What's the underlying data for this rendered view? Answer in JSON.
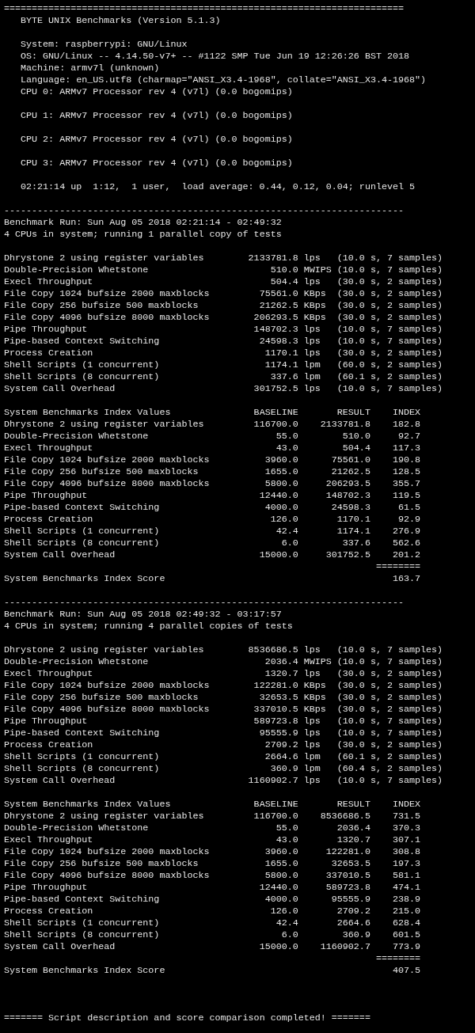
{
  "header": {
    "rule": "========================================================================",
    "title": "BYTE UNIX Benchmarks (Version 5.1.3)",
    "groups": [
      [
        "System: raspberrypi: GNU/Linux",
        "OS: GNU/Linux -- 4.14.50-v7+ -- #1122 SMP Tue Jun 19 12:26:26 BST 2018",
        "Machine: armv7l (unknown)",
        "Language: en_US.utf8 (charmap=\"ANSI_X3.4-1968\", collate=\"ANSI_X3.4-1968\")",
        "CPU 0: ARMv7 Processor rev 4 (v7l) (0.0 bogomips)"
      ],
      [
        "CPU 1: ARMv7 Processor rev 4 (v7l) (0.0 bogomips)"
      ],
      [
        "CPU 2: ARMv7 Processor rev 4 (v7l) (0.0 bogomips)"
      ],
      [
        "CPU 3: ARMv7 Processor rev 4 (v7l) (0.0 bogomips)"
      ],
      [
        "02:21:14 up  1:12,  1 user,  load average: 0.44, 0.12, 0.04; runlevel 5"
      ]
    ]
  },
  "runs": [
    {
      "rule": "------------------------------------------------------------------------",
      "run": "Benchmark Run: Sun Aug 05 2018 02:21:14 - 02:49:32",
      "cpus": "4 CPUs in system; running 1 parallel copy of tests",
      "results": [
        {
          "test": "Dhrystone 2 using register variables",
          "value": "2133781.8",
          "unit": "lps",
          "timing": "(10.0 s, 7 samples)"
        },
        {
          "test": "Double-Precision Whetstone",
          "value": "510.0",
          "unit": "MWIPS",
          "timing": "(10.0 s, 7 samples)"
        },
        {
          "test": "Execl Throughput",
          "value": "504.4",
          "unit": "lps",
          "timing": "(30.0 s, 2 samples)"
        },
        {
          "test": "File Copy 1024 bufsize 2000 maxblocks",
          "value": "75561.0",
          "unit": "KBps",
          "timing": "(30.0 s, 2 samples)"
        },
        {
          "test": "File Copy 256 bufsize 500 maxblocks",
          "value": "21262.5",
          "unit": "KBps",
          "timing": "(30.0 s, 2 samples)"
        },
        {
          "test": "File Copy 4096 bufsize 8000 maxblocks",
          "value": "206293.5",
          "unit": "KBps",
          "timing": "(30.0 s, 2 samples)"
        },
        {
          "test": "Pipe Throughput",
          "value": "148702.3",
          "unit": "lps",
          "timing": "(10.0 s, 7 samples)"
        },
        {
          "test": "Pipe-based Context Switching",
          "value": "24598.3",
          "unit": "lps",
          "timing": "(10.0 s, 7 samples)"
        },
        {
          "test": "Process Creation",
          "value": "1170.1",
          "unit": "lps",
          "timing": "(30.0 s, 2 samples)"
        },
        {
          "test": "Shell Scripts (1 concurrent)",
          "value": "1174.1",
          "unit": "lpm",
          "timing": "(60.0 s, 2 samples)"
        },
        {
          "test": "Shell Scripts (8 concurrent)",
          "value": "337.6",
          "unit": "lpm",
          "timing": "(60.1 s, 2 samples)"
        },
        {
          "test": "System Call Overhead",
          "value": "301752.5",
          "unit": "lps",
          "timing": "(10.0 s, 7 samples)"
        }
      ],
      "index": {
        "title": "System Benchmarks Index Values",
        "columns": [
          "BASELINE",
          "RESULT",
          "INDEX"
        ],
        "rows": [
          {
            "test": "Dhrystone 2 using register variables",
            "baseline": "116700.0",
            "result": "2133781.8",
            "index": "182.8"
          },
          {
            "test": "Double-Precision Whetstone",
            "baseline": "55.0",
            "result": "510.0",
            "index": "92.7"
          },
          {
            "test": "Execl Throughput",
            "baseline": "43.0",
            "result": "504.4",
            "index": "117.3"
          },
          {
            "test": "File Copy 1024 bufsize 2000 maxblocks",
            "baseline": "3960.0",
            "result": "75561.0",
            "index": "190.8"
          },
          {
            "test": "File Copy 256 bufsize 500 maxblocks",
            "baseline": "1655.0",
            "result": "21262.5",
            "index": "128.5"
          },
          {
            "test": "File Copy 4096 bufsize 8000 maxblocks",
            "baseline": "5800.0",
            "result": "206293.5",
            "index": "355.7"
          },
          {
            "test": "Pipe Throughput",
            "baseline": "12440.0",
            "result": "148702.3",
            "index": "119.5"
          },
          {
            "test": "Pipe-based Context Switching",
            "baseline": "4000.0",
            "result": "24598.3",
            "index": "61.5"
          },
          {
            "test": "Process Creation",
            "baseline": "126.0",
            "result": "1170.1",
            "index": "92.9"
          },
          {
            "test": "Shell Scripts (1 concurrent)",
            "baseline": "42.4",
            "result": "1174.1",
            "index": "276.9"
          },
          {
            "test": "Shell Scripts (8 concurrent)",
            "baseline": "6.0",
            "result": "337.6",
            "index": "562.6"
          },
          {
            "test": "System Call Overhead",
            "baseline": "15000.0",
            "result": "301752.5",
            "index": "201.2"
          }
        ],
        "rule": "========",
        "score_label": "System Benchmarks Index Score",
        "score": "163.7"
      }
    },
    {
      "rule": "------------------------------------------------------------------------",
      "run": "Benchmark Run: Sun Aug 05 2018 02:49:32 - 03:17:57",
      "cpus": "4 CPUs in system; running 4 parallel copies of tests",
      "results": [
        {
          "test": "Dhrystone 2 using register variables",
          "value": "8536686.5",
          "unit": "lps",
          "timing": "(10.0 s, 7 samples)"
        },
        {
          "test": "Double-Precision Whetstone",
          "value": "2036.4",
          "unit": "MWIPS",
          "timing": "(10.0 s, 7 samples)"
        },
        {
          "test": "Execl Throughput",
          "value": "1320.7",
          "unit": "lps",
          "timing": "(30.0 s, 2 samples)"
        },
        {
          "test": "File Copy 1024 bufsize 2000 maxblocks",
          "value": "122281.0",
          "unit": "KBps",
          "timing": "(30.0 s, 2 samples)"
        },
        {
          "test": "File Copy 256 bufsize 500 maxblocks",
          "value": "32653.5",
          "unit": "KBps",
          "timing": "(30.0 s, 2 samples)"
        },
        {
          "test": "File Copy 4096 bufsize 8000 maxblocks",
          "value": "337010.5",
          "unit": "KBps",
          "timing": "(30.0 s, 2 samples)"
        },
        {
          "test": "Pipe Throughput",
          "value": "589723.8",
          "unit": "lps",
          "timing": "(10.0 s, 7 samples)"
        },
        {
          "test": "Pipe-based Context Switching",
          "value": "95555.9",
          "unit": "lps",
          "timing": "(10.0 s, 7 samples)"
        },
        {
          "test": "Process Creation",
          "value": "2709.2",
          "unit": "lps",
          "timing": "(30.0 s, 2 samples)"
        },
        {
          "test": "Shell Scripts (1 concurrent)",
          "value": "2664.6",
          "unit": "lpm",
          "timing": "(60.1 s, 2 samples)"
        },
        {
          "test": "Shell Scripts (8 concurrent)",
          "value": "360.9",
          "unit": "lpm",
          "timing": "(60.4 s, 2 samples)"
        },
        {
          "test": "System Call Overhead",
          "value": "1160902.7",
          "unit": "lps",
          "timing": "(10.0 s, 7 samples)"
        }
      ],
      "index": {
        "title": "System Benchmarks Index Values",
        "columns": [
          "BASELINE",
          "RESULT",
          "INDEX"
        ],
        "rows": [
          {
            "test": "Dhrystone 2 using register variables",
            "baseline": "116700.0",
            "result": "8536686.5",
            "index": "731.5"
          },
          {
            "test": "Double-Precision Whetstone",
            "baseline": "55.0",
            "result": "2036.4",
            "index": "370.3"
          },
          {
            "test": "Execl Throughput",
            "baseline": "43.0",
            "result": "1320.7",
            "index": "307.1"
          },
          {
            "test": "File Copy 1024 bufsize 2000 maxblocks",
            "baseline": "3960.0",
            "result": "122281.0",
            "index": "308.8"
          },
          {
            "test": "File Copy 256 bufsize 500 maxblocks",
            "baseline": "1655.0",
            "result": "32653.5",
            "index": "197.3"
          },
          {
            "test": "File Copy 4096 bufsize 8000 maxblocks",
            "baseline": "5800.0",
            "result": "337010.5",
            "index": "581.1"
          },
          {
            "test": "Pipe Throughput",
            "baseline": "12440.0",
            "result": "589723.8",
            "index": "474.1"
          },
          {
            "test": "Pipe-based Context Switching",
            "baseline": "4000.0",
            "result": "95555.9",
            "index": "238.9"
          },
          {
            "test": "Process Creation",
            "baseline": "126.0",
            "result": "2709.2",
            "index": "215.0"
          },
          {
            "test": "Shell Scripts (1 concurrent)",
            "baseline": "42.4",
            "result": "2664.6",
            "index": "628.4"
          },
          {
            "test": "Shell Scripts (8 concurrent)",
            "baseline": "6.0",
            "result": "360.9",
            "index": "601.5"
          },
          {
            "test": "System Call Overhead",
            "baseline": "15000.0",
            "result": "1160902.7",
            "index": "773.9"
          }
        ],
        "rule": "========",
        "score_label": "System Benchmarks Index Score",
        "score": "407.5"
      }
    }
  ],
  "footer": "======= Script description and score comparison completed! ======="
}
